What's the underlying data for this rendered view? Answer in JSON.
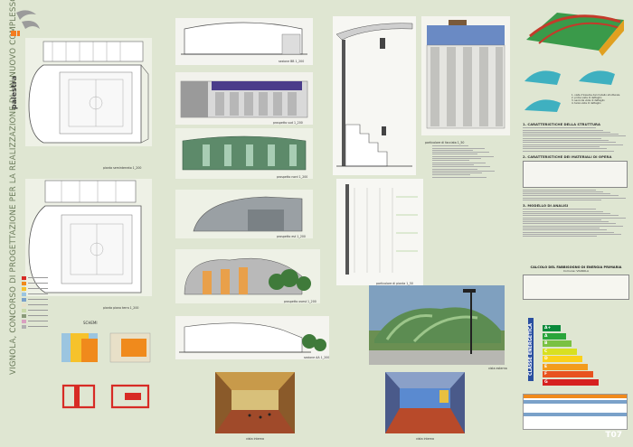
{
  "vertical_title": "VIGNOLA, CONCORSO DI PROGETTAZIONE PER LA REALIZZAZIONE DI UN NUOVO COMPLESSO SCOLASTICO",
  "side_label": "palestra",
  "sheet_code": "T07",
  "labels": {
    "plan_ground": "pianta seminterrato 1_200",
    "plan_floor": "pianta piano terra 1_200",
    "schemi": "SCHEMI",
    "section_bb": "sezione BB 1_200",
    "prospect_south": "prospetto sud 1_200",
    "prospect_north": "prospetto nord 1_200",
    "prospect_east": "prospetto est 1_200",
    "prospect_west": "prospetto ovest 1_200",
    "section_aa": "sezione AA 1_200",
    "detail_section": "particolare di sezione 1_50",
    "detail_facade": "particolare di facciata 1_50",
    "detail_plan": "particolare di pianta 1_50",
    "view_external": "vista esterna",
    "view_internal_1": "vista interna",
    "view_internal_2": "vista interna"
  },
  "structure_legend": [
    "1. vista d'insieme del modello strutturale",
    "2. prima vista di dettaglio",
    "3. seconda vista di dettaglio",
    "4. terza vista di dettaglio"
  ],
  "sections": [
    "1. CARATTERISTICHE DELLA STRUTTURA",
    "2. CARATTERISTICHE DEI MATERIALI DI OPERA",
    "3. MODELLO DI ANALISI"
  ],
  "energy": {
    "title": "CALCOLO DEL FABBISOGNO DI ENERGIA PRIMARIA",
    "comune": "Comune: VIGNOLA",
    "classe": "CLASSE ENERGETICA",
    "grades": [
      "A+",
      "A",
      "B",
      "C",
      "D",
      "E",
      "F",
      "G"
    ],
    "grade_colors": [
      "#0a8a3a",
      "#2aa53a",
      "#7ac143",
      "#d8e021",
      "#fbd11a",
      "#f39c1d",
      "#e8531f",
      "#d6201f"
    ]
  },
  "legend_colors": [
    "#d72b25",
    "#f08a1c",
    "#f6c22b",
    "#9bc5e0",
    "#7aa1c9",
    "#e8e0c8",
    "#c8d9a8",
    "#8a9a7a",
    "#d9a0c0",
    "#b0b0b0"
  ]
}
